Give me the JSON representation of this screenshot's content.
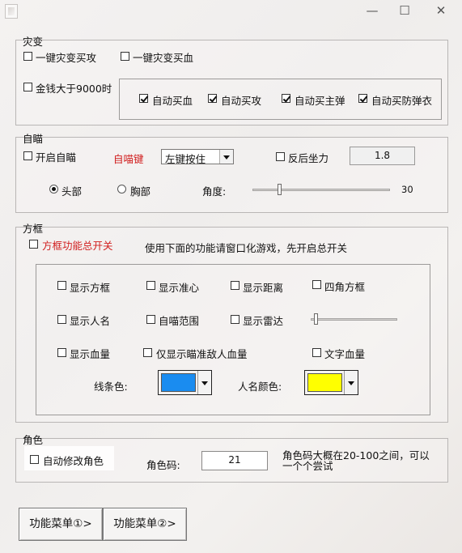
{
  "window": {
    "minimize": "—",
    "maximize": "☐",
    "close": "✕"
  },
  "disaster": {
    "title": "灾变",
    "buy_attack": "一键灾变买攻",
    "buy_hp": "一键灾变买血",
    "money_over": "金钱大于9000时",
    "auto_buy_hp": "自动买血",
    "auto_buy_attack": "自动买攻",
    "auto_buy_main_ammo": "自动买主弹",
    "auto_buy_armor": "自动买防弹衣"
  },
  "aim": {
    "title": "自瞄",
    "enable": "开启自瞄",
    "aim_key_label": "自喵键",
    "aim_key_value": "左键按住",
    "recoil": "反后坐力",
    "recoil_value": "1.8",
    "head": "头部",
    "chest": "胸部",
    "angle_label": "角度:",
    "angle_value": "30",
    "angle_fraction": 0.2
  },
  "box": {
    "title": "方框",
    "master_switch": "方框功能总开关",
    "hint": "使用下面的功能请窗口化游戏，先开启总开关",
    "show_box": "显示方框",
    "show_crosshair": "显示准心",
    "show_distance": "显示距离",
    "corner_box": "四角方框",
    "show_name": "显示人名",
    "aim_range": "自喵范围",
    "show_radar": "显示雷达",
    "radar_fraction": 0.07,
    "show_hp": "显示血量",
    "show_aimed_hp": "仅显示瞄准敌人血量",
    "text_hp": "文字血量",
    "line_color_label": "线条色:",
    "line_color": "#1a8cf0",
    "name_color_label": "人名颜色:",
    "name_color": "#ffff00"
  },
  "role": {
    "title": "角色",
    "auto_modify": "自动修改角色",
    "code_label": "角色码:",
    "code_value": "21",
    "note": "角色码大概在20-100之间，可以一个个尝试"
  },
  "menu": {
    "button1": "功能菜单①>",
    "button2": "功能菜单②>"
  }
}
